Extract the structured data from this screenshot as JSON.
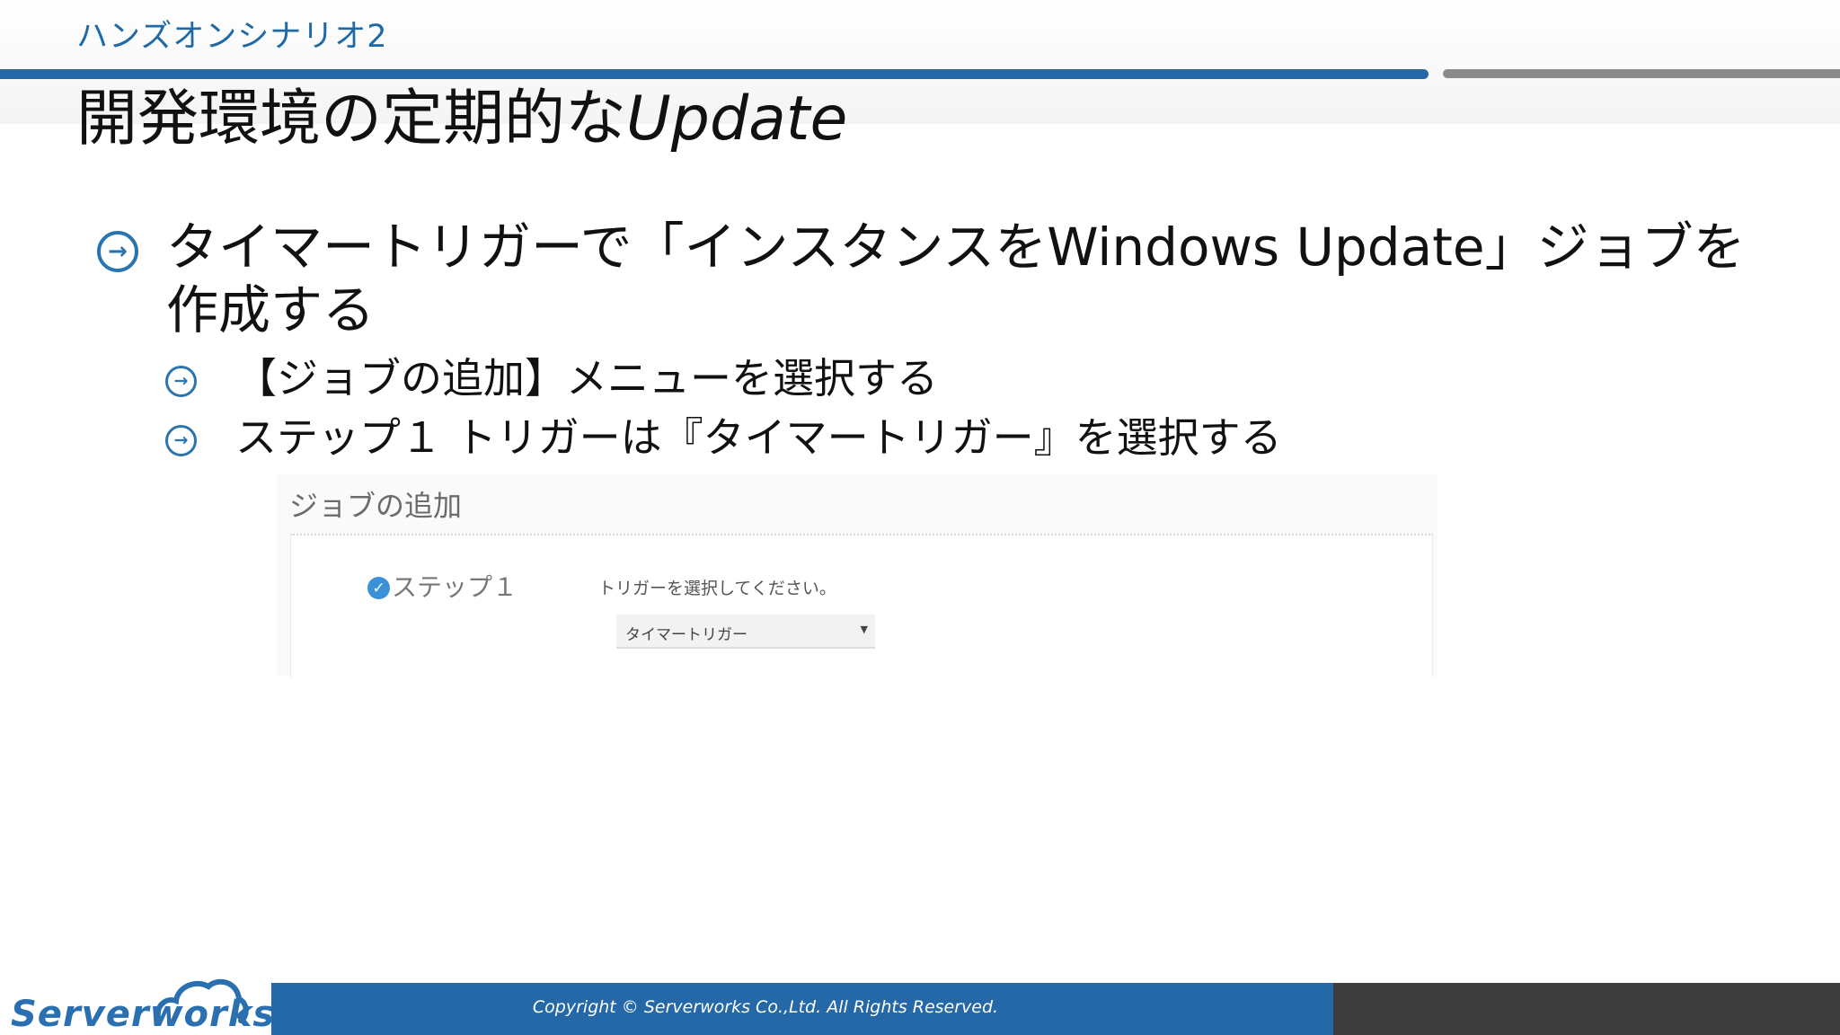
{
  "header": {
    "section": "ハンズオンシナリオ2",
    "title_main": "開発環境の定期的な",
    "title_italic": "Update"
  },
  "bullets": {
    "level1": "タイマートリガーで「インスタンスをWindows Update」ジョブを作成する",
    "level2": [
      "【ジョブの追加】メニューを選択する",
      "ステップ１ トリガーは『タイマートリガー』を選択する"
    ]
  },
  "panel": {
    "title": "ジョブの追加",
    "step_label": "ステップ１",
    "trigger_prompt": "トリガーを選択してください。",
    "trigger_selected": "タイマートリガー"
  },
  "footer": {
    "logo_text": "Serverworks",
    "copyright": "Copyright ©  Serverworks Co.,Ltd. All Rights Reserved."
  },
  "colors": {
    "accent_blue": "#2468a8",
    "footer_dark": "#3d3d3d",
    "check_blue": "#3b91d8"
  },
  "icons": {
    "bullet": "circle-arrow-right-icon",
    "step_status": "check-circle-icon",
    "select": "chevron-down-icon",
    "logo": "cloud-icon"
  }
}
